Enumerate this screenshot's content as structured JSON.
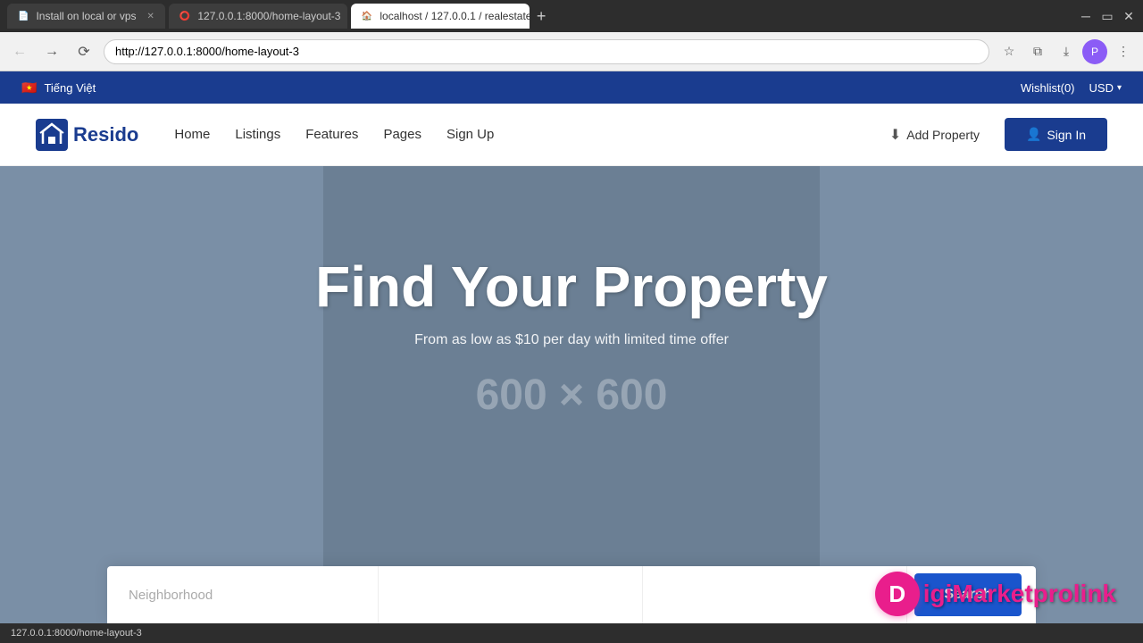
{
  "browser": {
    "tabs": [
      {
        "id": "tab1",
        "title": "Install on local or vps",
        "favicon": "📄",
        "active": false,
        "loading": false
      },
      {
        "id": "tab2",
        "title": "127.0.0.1:8000/home-layout-3",
        "favicon": "⭕",
        "active": false,
        "loading": true
      },
      {
        "id": "tab3",
        "title": "localhost / 127.0.0.1 / realestate",
        "favicon": "🏠",
        "active": true,
        "loading": false
      }
    ],
    "address": "http://127.0.0.1:8000/home-layout-3",
    "status_bar_text": "127.0.0.1:8000/home-layout-3"
  },
  "topbar": {
    "language": "Tiếng Việt",
    "flag": "🇻🇳",
    "wishlist_label": "Wishlist(0)",
    "currency": "USD",
    "currency_chevron": "▾"
  },
  "navbar": {
    "logo_text": "Resido",
    "nav_links": [
      {
        "label": "Home"
      },
      {
        "label": "Listings"
      },
      {
        "label": "Features"
      },
      {
        "label": "Pages"
      },
      {
        "label": "Sign Up"
      }
    ],
    "add_property_label": "Add Property",
    "sign_in_label": "Sign In"
  },
  "hero": {
    "title": "Find Your Property",
    "subtitle": "From as low as $10 per day with limited time offer",
    "placeholder_image": "600 × 600"
  },
  "search": {
    "placeholder1": "Neighborhood",
    "placeholder2": "",
    "placeholder3": "",
    "button_label": "Search"
  },
  "watermark": {
    "letter": "D",
    "text_part1": "igiMarketpro",
    "text_part2": "link"
  }
}
